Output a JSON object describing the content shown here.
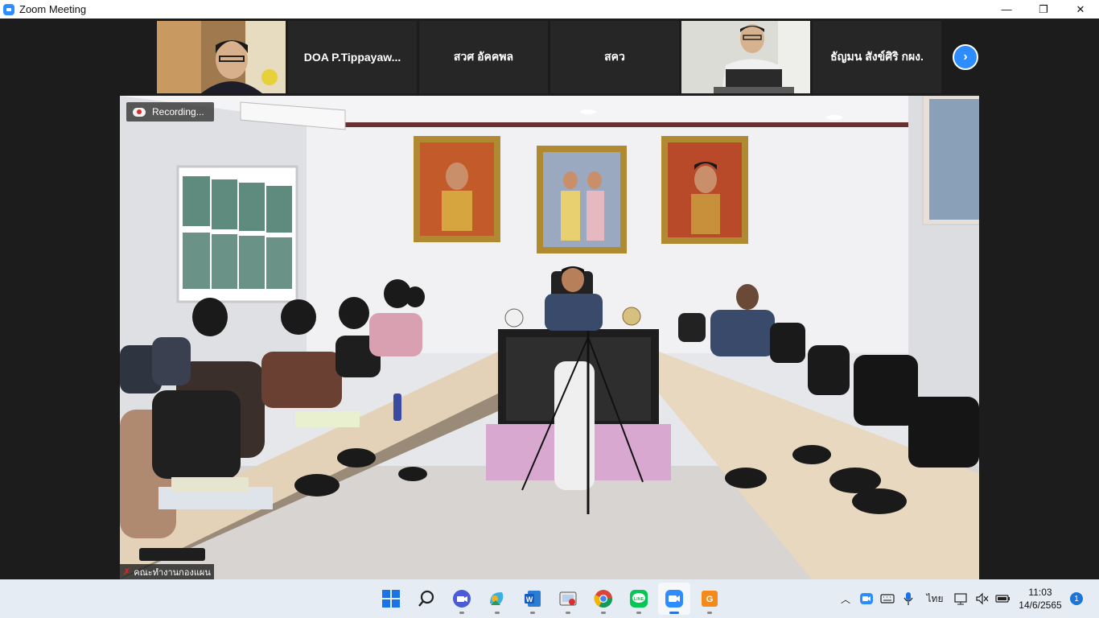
{
  "window": {
    "title": "Zoom Meeting",
    "minimize": "—",
    "maximize": "❐",
    "close": "✕"
  },
  "participants": [
    {
      "name": "",
      "type": "video"
    },
    {
      "name": "DOA  P.Tippayaw...",
      "type": "name"
    },
    {
      "name": "สวศ อัคคพล",
      "type": "name"
    },
    {
      "name": "สคว",
      "type": "name"
    },
    {
      "name": "",
      "type": "video"
    },
    {
      "name": "ธัญมน สังข์ศิริ กผง.",
      "type": "name"
    }
  ],
  "next_page_icon": "chevron-right-icon",
  "main_video": {
    "recording_label": "Recording...",
    "speaker_name": "คณะทำงานกองแผน"
  },
  "taskbar": {
    "apps": [
      "windows-start",
      "search",
      "zoom-app",
      "photos",
      "word",
      "screen-capture",
      "chrome",
      "line",
      "zoom-meeting",
      "pdf-app"
    ],
    "active_app": "zoom-meeting",
    "language": "ไทย",
    "time": "11:03",
    "date": "14/6/2565",
    "notifications": "1"
  },
  "colors": {
    "accent": "#2d8cff",
    "taskbar": "#e6ecf4",
    "meeting_bg": "#1c1c1c"
  }
}
